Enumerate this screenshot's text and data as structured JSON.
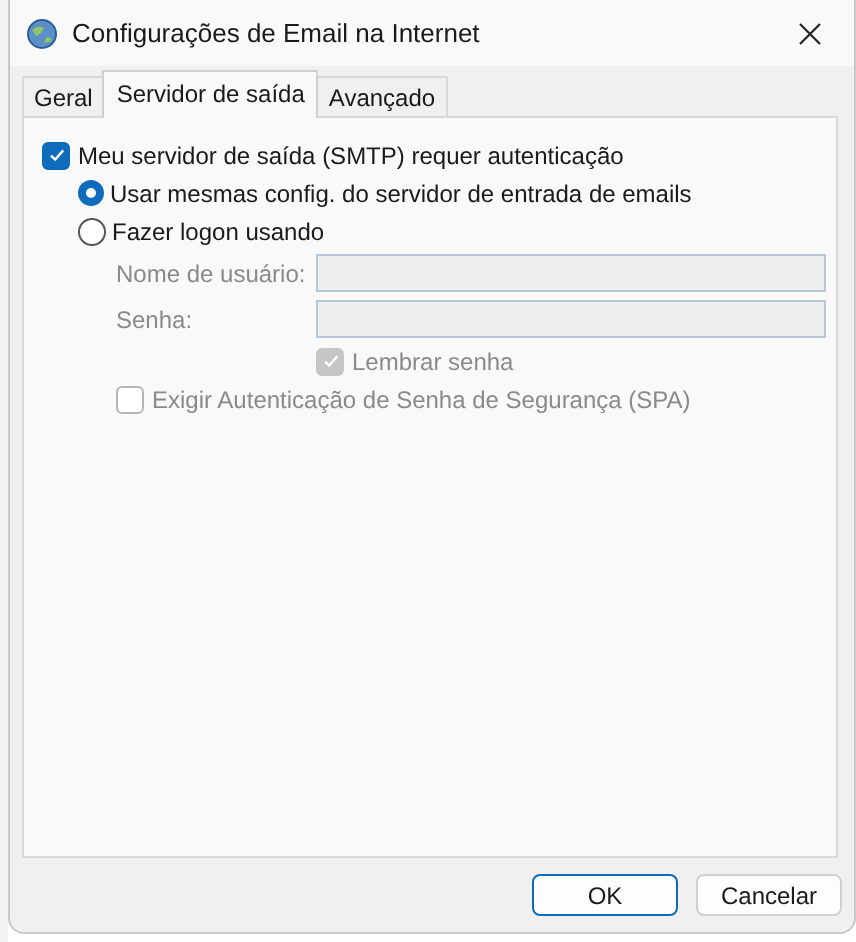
{
  "window": {
    "title": "Configurações de Email na Internet"
  },
  "tabs": [
    {
      "label": "Geral",
      "selected": false
    },
    {
      "label": "Servidor de saída",
      "selected": true
    },
    {
      "label": "Avançado",
      "selected": false
    }
  ],
  "smtp_auth": {
    "label": "Meu servidor de saída (SMTP) requer autenticação",
    "checked": true
  },
  "auth_options": [
    {
      "label": "Usar mesmas config. do servidor de entrada de emails",
      "selected": true
    },
    {
      "label": "Fazer logon usando",
      "selected": false
    }
  ],
  "fields": [
    {
      "label": "Nome de usuário:",
      "disabled": true
    },
    {
      "label": "Senha:",
      "disabled": true
    }
  ],
  "remember_password": {
    "label": "Lembrar senha",
    "checked": true,
    "disabled": true
  },
  "spa": {
    "label": "Exigir Autenticação de Senha de Segurança (SPA)",
    "checked": false,
    "disabled": true
  },
  "buttons": [
    {
      "label": "OK",
      "default": true
    },
    {
      "label": "Cancelar",
      "default": false
    }
  ]
}
